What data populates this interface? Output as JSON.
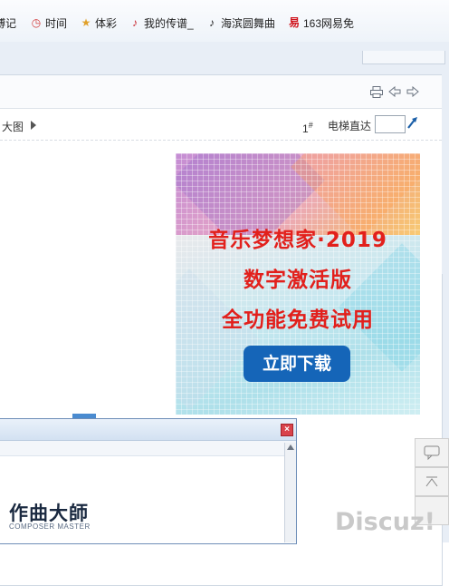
{
  "bookmarks": [
    {
      "label": "博记",
      "icon": "document-icon",
      "icon_glyph": "",
      "icon_color": "#3a6fb0"
    },
    {
      "label": "时间",
      "icon": "clock-icon",
      "icon_glyph": "◷",
      "icon_color": "#d23a3a"
    },
    {
      "label": "体彩",
      "icon": "star-icon",
      "icon_glyph": "★",
      "icon_color": "#e0a02a"
    },
    {
      "label": "我的传谱_",
      "icon": "music-logo-icon",
      "icon_glyph": "♪",
      "icon_color": "#c8262e"
    },
    {
      "label": "海滨圆舞曲",
      "icon": "music-note-icon",
      "icon_glyph": "♪",
      "icon_color": "#222222"
    },
    {
      "label": "163网易免",
      "icon": "netease-icon",
      "icon_glyph": "易",
      "icon_color": "#d0141d"
    }
  ],
  "toolbar": {
    "print_icon": "printer-icon",
    "prev_icon": "arrow-left-icon",
    "next_icon": "arrow-right-icon"
  },
  "post": {
    "view_large": "大图",
    "floor": "1",
    "floor_suffix": "#",
    "elevator_label": "电梯直达",
    "elevator_value": ""
  },
  "ad": {
    "line1": "音乐梦想家·2019",
    "line2": "数字激活版",
    "line3": "全功能免费试用",
    "button": "立即下载",
    "text_color": "#e2201c",
    "button_color": "#1565b8"
  },
  "popup": {
    "logo_cn": "作曲大師",
    "logo_en": "COMPOSER MASTER",
    "close_label": "×"
  },
  "side": {
    "watermark": "Discuz!"
  }
}
